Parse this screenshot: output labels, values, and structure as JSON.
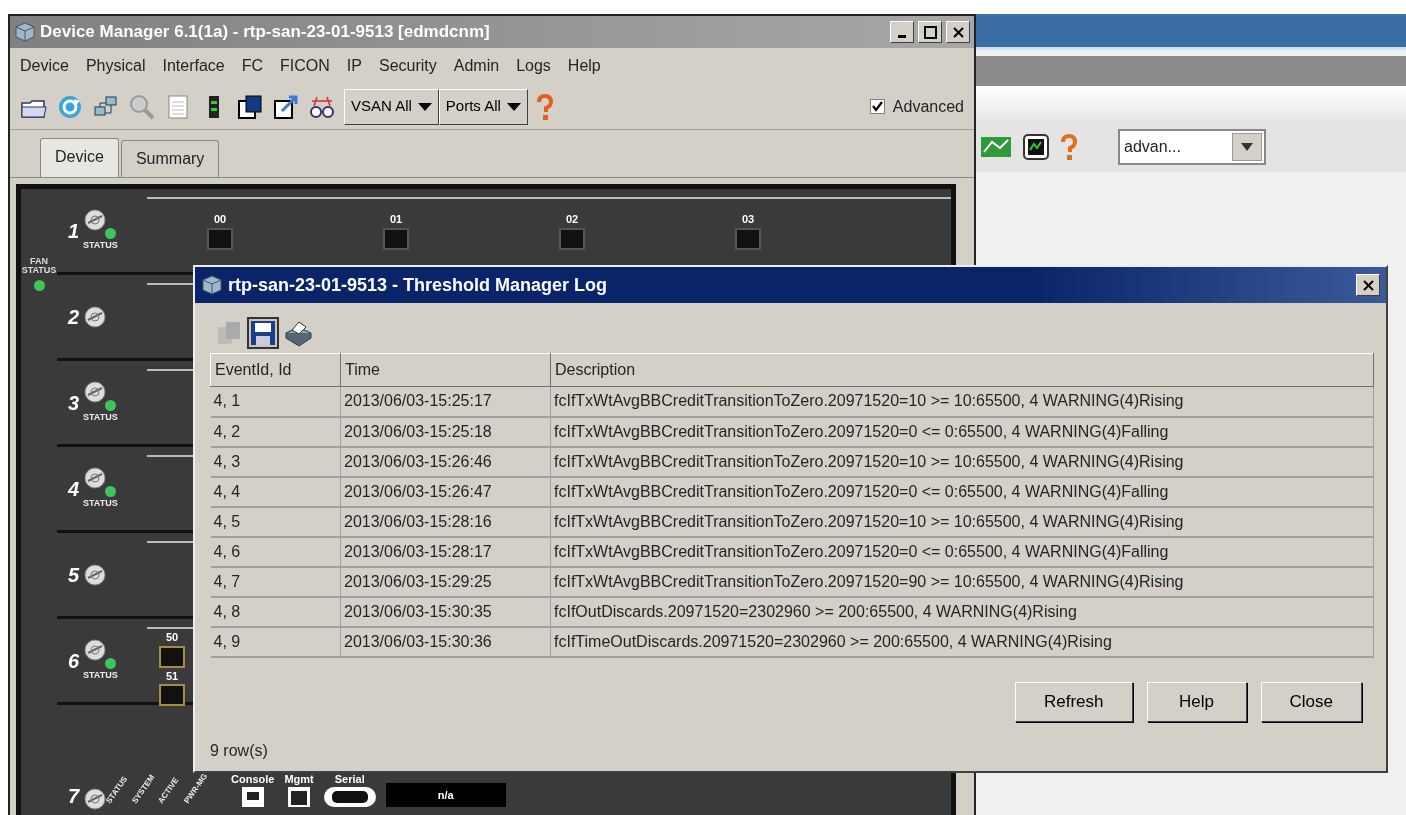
{
  "device_manager": {
    "title": "Device Manager 6.1(1a) - rtp-san-23-01-9513 [edmdcnm]",
    "menu": [
      "Device",
      "Physical",
      "Interface",
      "FC",
      "FICON",
      "IP",
      "Security",
      "Admin",
      "Logs",
      "Help"
    ],
    "toolbar": {
      "dropdowns": [
        "VSAN All",
        "Ports All"
      ],
      "advanced": {
        "label": "Advanced",
        "checked": true
      }
    },
    "tabs": [
      {
        "label": "Device",
        "selected": true
      },
      {
        "label": "Summary",
        "selected": false
      }
    ],
    "chassis": {
      "fan_status": {
        "label": "FAN STATUS",
        "on": true
      },
      "slots": [
        {
          "number": "1",
          "kind": "ports_top",
          "status_label": "STATUS",
          "status_led": true,
          "ports": [
            "00",
            "01",
            "02",
            "03"
          ]
        },
        {
          "number": "2",
          "kind": "blank",
          "status_led": false
        },
        {
          "number": "3",
          "kind": "blank",
          "status_label": "STATUS",
          "status_led": true
        },
        {
          "number": "4",
          "kind": "blank",
          "status_label": "STATUS",
          "status_led": true
        },
        {
          "number": "5",
          "kind": "blank",
          "status_led": false
        },
        {
          "number": "6",
          "kind": "ports_side",
          "status_label": "STATUS",
          "status_led": true,
          "ports": [
            "50",
            "51"
          ]
        },
        {
          "number": "7",
          "kind": "supervisor",
          "status_led": false,
          "led_labels": [
            "STATUS",
            "SYSTEM",
            "ACTIVE",
            "PWR-MG"
          ],
          "port_labels": [
            "Console",
            "Mgmt",
            "Serial"
          ],
          "cf_value": "n/a"
        }
      ]
    }
  },
  "background_window": {
    "combo": "advan..."
  },
  "dialog": {
    "title": "rtp-san-23-01-9513 - Threshold Manager Log",
    "columns": [
      "EventId, Id",
      "Time",
      "Description"
    ],
    "rows": [
      [
        "4, 1",
        "2013/06/03-15:25:17",
        "fcIfTxWtAvgBBCreditTransitionToZero.20971520=10 >= 10:65500, 4 WARNING(4)Rising"
      ],
      [
        "4, 2",
        "2013/06/03-15:25:18",
        "fcIfTxWtAvgBBCreditTransitionToZero.20971520=0 <= 0:65500, 4 WARNING(4)Falling"
      ],
      [
        "4, 3",
        "2013/06/03-15:26:46",
        "fcIfTxWtAvgBBCreditTransitionToZero.20971520=10 >= 10:65500, 4 WARNING(4)Rising"
      ],
      [
        "4, 4",
        "2013/06/03-15:26:47",
        "fcIfTxWtAvgBBCreditTransitionToZero.20971520=0 <= 0:65500, 4 WARNING(4)Falling"
      ],
      [
        "4, 5",
        "2013/06/03-15:28:16",
        "fcIfTxWtAvgBBCreditTransitionToZero.20971520=10 >= 10:65500, 4 WARNING(4)Rising"
      ],
      [
        "4, 6",
        "2013/06/03-15:28:17",
        "fcIfTxWtAvgBBCreditTransitionToZero.20971520=0 <= 0:65500, 4 WARNING(4)Falling"
      ],
      [
        "4, 7",
        "2013/06/03-15:29:25",
        "fcIfTxWtAvgBBCreditTransitionToZero.20971520=90 >= 10:65500, 4 WARNING(4)Rising"
      ],
      [
        "4, 8",
        "2013/06/03-15:30:35",
        "fcIfOutDiscards.20971520=2302960 >= 200:65500, 4 WARNING(4)Rising"
      ],
      [
        "4, 9",
        "2013/06/03-15:30:36",
        "fcIfTimeOutDiscards.20971520=2302960 >= 200:65500, 4 WARNING(4)Rising"
      ]
    ],
    "buttons": [
      "Refresh",
      "Help",
      "Close"
    ],
    "row_count": "9 row(s)"
  }
}
